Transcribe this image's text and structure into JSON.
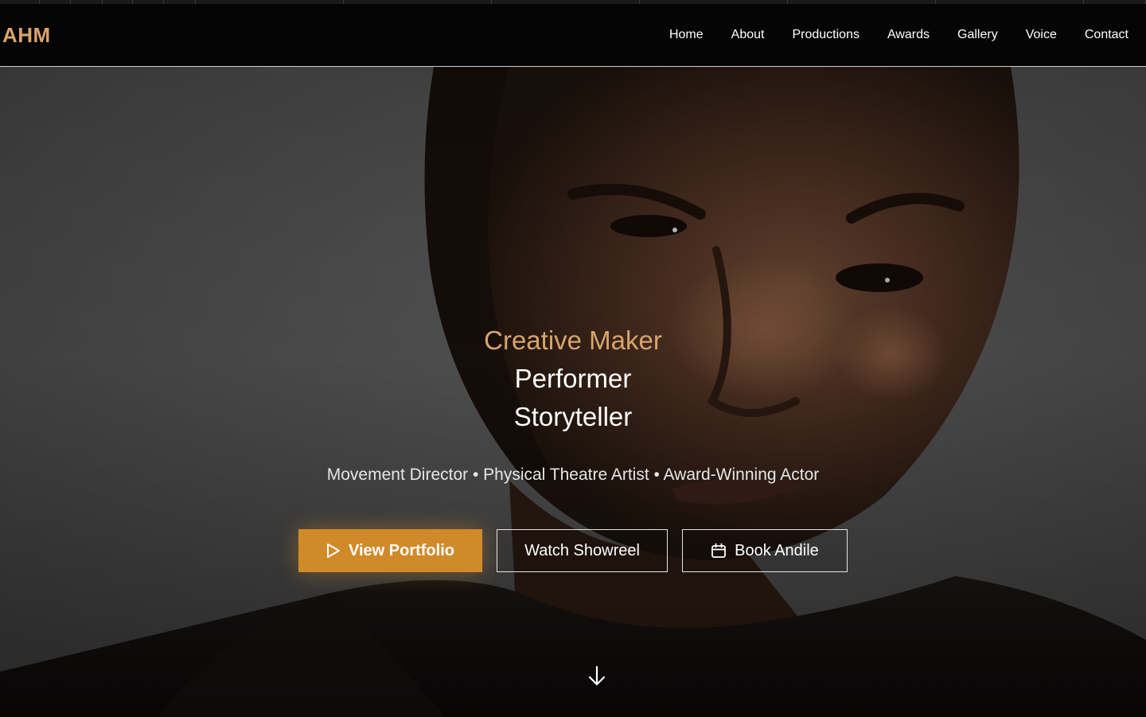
{
  "logo": "AHM",
  "nav": {
    "items": [
      "Home",
      "About",
      "Productions",
      "Awards",
      "Gallery",
      "Voice",
      "Contact"
    ]
  },
  "hero": {
    "roles": [
      "Creative Maker",
      "Performer",
      "Storyteller"
    ],
    "tagline": "Movement Director • Physical Theatre Artist • Award-Winning Actor",
    "buttons": {
      "portfolio": "View Portfolio",
      "showreel": "Watch Showreel",
      "book": "Book Andile"
    },
    "icons": {
      "portfolio": "play-icon",
      "book": "calendar-icon",
      "scroll": "arrow-down-icon"
    }
  },
  "colors": {
    "accent": "#d9a46b",
    "button_primary": "#d18a2a",
    "nav_background": "#050505",
    "hero_background": "#525252"
  }
}
